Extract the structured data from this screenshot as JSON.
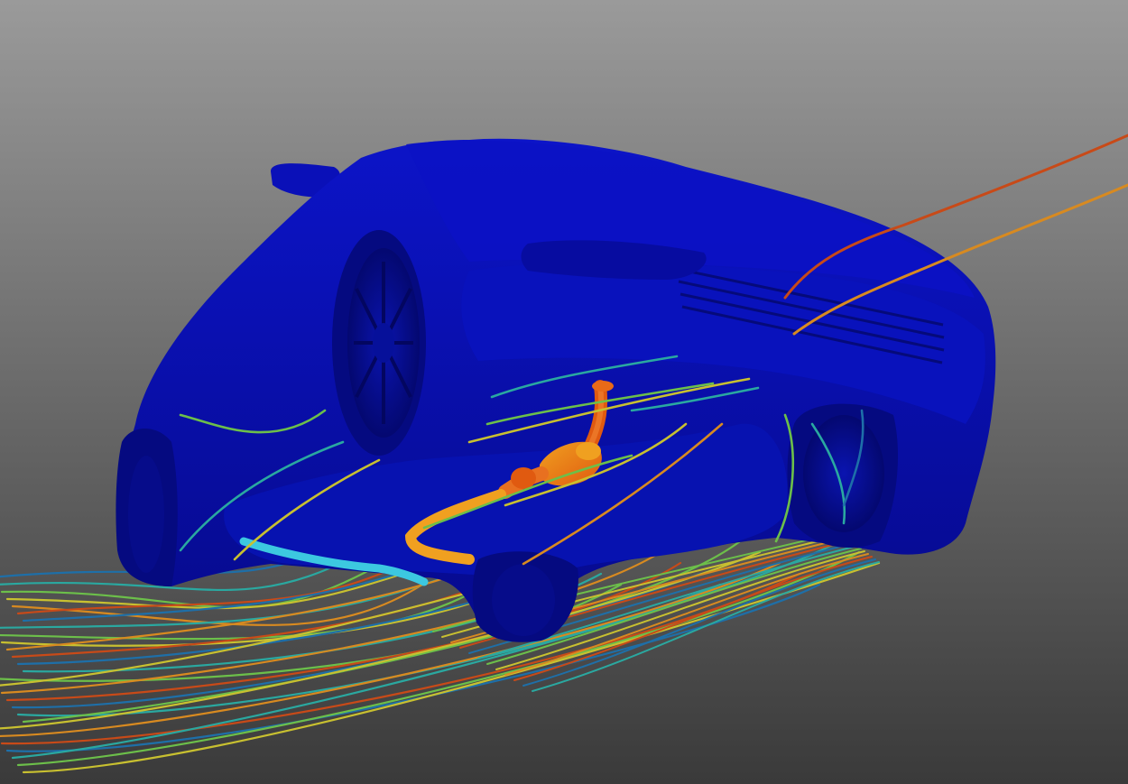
{
  "scene": {
    "background_top_color": "#9a9a9a",
    "background_bottom_color": "#3a3a3a",
    "car_body_color": "#0a0fb4",
    "car_shadow_color": "#050a7a",
    "car_highlight_color": "#1a22d8",
    "exhaust_hot_color": "#e05a10",
    "exhaust_warm_color": "#f0a020",
    "exhaust_cool_color": "#3cc8e0",
    "streamline_colors": [
      "#1e6fa8",
      "#2aa8a0",
      "#6cbf4a",
      "#c8c030",
      "#d88a20",
      "#c84a18"
    ]
  }
}
